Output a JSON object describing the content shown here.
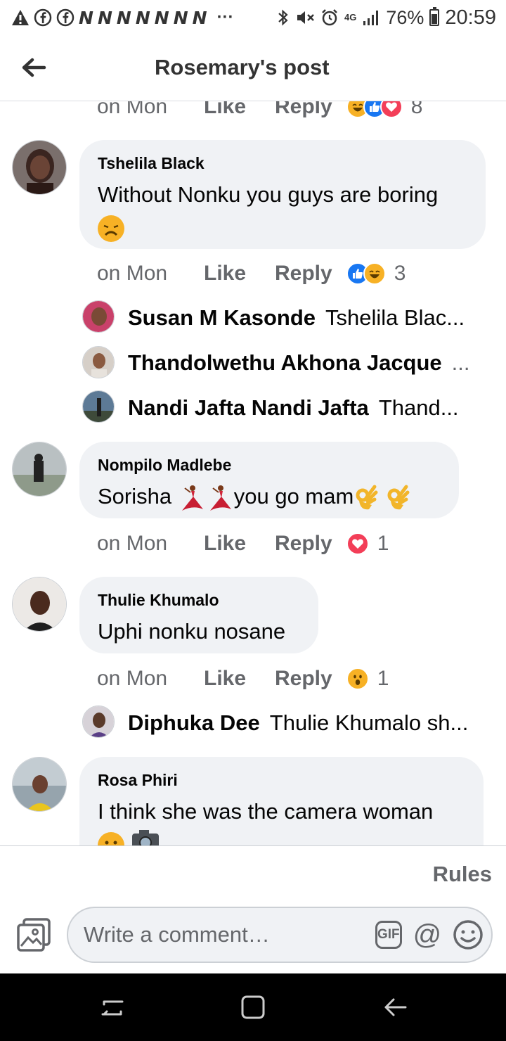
{
  "status_bar": {
    "left_icons": [
      "warning-icon",
      "facebook-icon",
      "facebook-icon",
      "n-icon",
      "n-icon",
      "n-icon",
      "n-icon",
      "n-icon",
      "n-icon",
      "n-icon"
    ],
    "n_glyph": "N",
    "more": "···",
    "network": "4G",
    "battery": "76%",
    "time": "20:59"
  },
  "header": {
    "title": "Rosemary's post"
  },
  "comments": [
    {
      "time": "on Mon",
      "like": "Like",
      "reply": "Reply",
      "reactions": [
        "haha",
        "like",
        "love"
      ],
      "reaction_count": "8"
    },
    {
      "author": "Tshelila Black",
      "text": "Without Nonku you guys are boring",
      "time": "on Mon",
      "like": "Like",
      "reply": "Reply",
      "reactions": [
        "like",
        "haha"
      ],
      "reaction_count": "3",
      "replies": [
        {
          "name": "Susan M Kasonde",
          "text": "Tshelila Blac..."
        },
        {
          "name": "Thandolwethu Akhona Jacque",
          "text": "..."
        },
        {
          "name": "Nandi Jafta Nandi Jafta",
          "text": "Thand..."
        }
      ]
    },
    {
      "author": "Nompilo Madlebe",
      "text_parts": [
        "Sorisha ",
        "you go mam"
      ],
      "time": "on Mon",
      "like": "Like",
      "reply": "Reply",
      "reactions": [
        "love"
      ],
      "reaction_count": "1"
    },
    {
      "author": "Thulie Khumalo",
      "text": "Uphi nonku nosane",
      "time": "on Mon",
      "like": "Like",
      "reply": "Reply",
      "reactions": [
        "wow"
      ],
      "reaction_count": "1",
      "replies": [
        {
          "name": "Diphuka Dee",
          "text": "Thulie Khumalo sh..."
        }
      ]
    },
    {
      "author": "Rosa Phiri",
      "text": "I think she was the camera woman"
    }
  ],
  "footer": {
    "rules": "Rules",
    "input_placeholder": "Write a comment…",
    "gif_label": "GIF",
    "mention_label": "@"
  },
  "colors": {
    "bubble": "#f0f2f5",
    "secondary_text": "#65676b",
    "like_blue": "#1877f2",
    "love_red": "#f33e58",
    "emoji_yellow": "#f7b125"
  }
}
